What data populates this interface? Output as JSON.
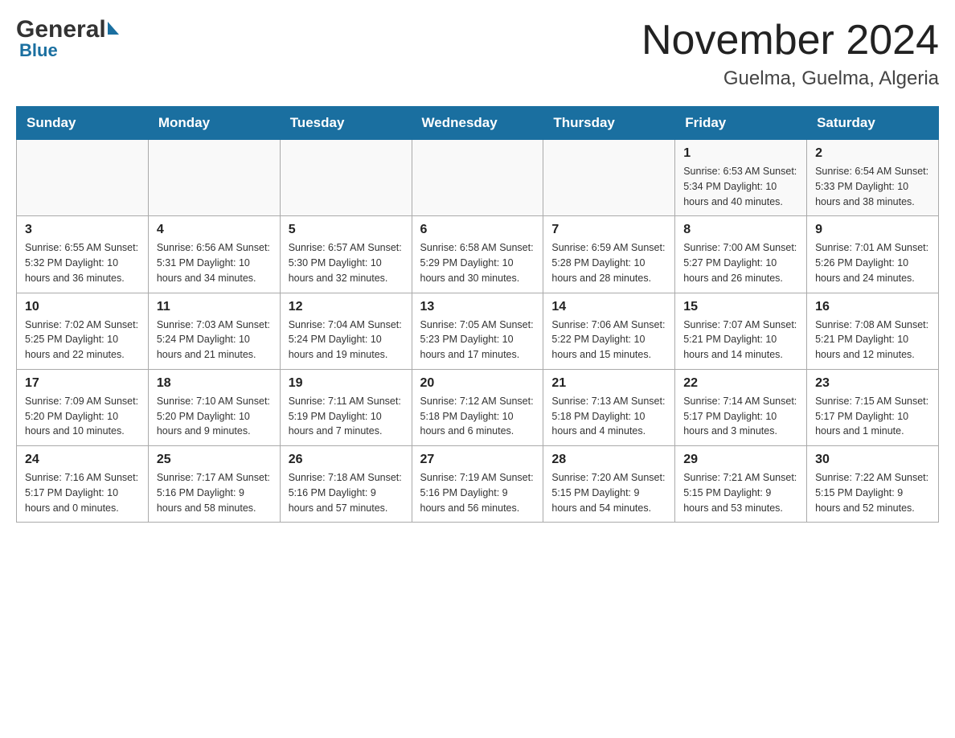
{
  "logo": {
    "general": "General",
    "blue": "Blue"
  },
  "title": "November 2024",
  "location": "Guelma, Guelma, Algeria",
  "days_of_week": [
    "Sunday",
    "Monday",
    "Tuesday",
    "Wednesday",
    "Thursday",
    "Friday",
    "Saturday"
  ],
  "weeks": [
    [
      {
        "day": "",
        "info": ""
      },
      {
        "day": "",
        "info": ""
      },
      {
        "day": "",
        "info": ""
      },
      {
        "day": "",
        "info": ""
      },
      {
        "day": "",
        "info": ""
      },
      {
        "day": "1",
        "info": "Sunrise: 6:53 AM\nSunset: 5:34 PM\nDaylight: 10 hours and 40 minutes."
      },
      {
        "day": "2",
        "info": "Sunrise: 6:54 AM\nSunset: 5:33 PM\nDaylight: 10 hours and 38 minutes."
      }
    ],
    [
      {
        "day": "3",
        "info": "Sunrise: 6:55 AM\nSunset: 5:32 PM\nDaylight: 10 hours and 36 minutes."
      },
      {
        "day": "4",
        "info": "Sunrise: 6:56 AM\nSunset: 5:31 PM\nDaylight: 10 hours and 34 minutes."
      },
      {
        "day": "5",
        "info": "Sunrise: 6:57 AM\nSunset: 5:30 PM\nDaylight: 10 hours and 32 minutes."
      },
      {
        "day": "6",
        "info": "Sunrise: 6:58 AM\nSunset: 5:29 PM\nDaylight: 10 hours and 30 minutes."
      },
      {
        "day": "7",
        "info": "Sunrise: 6:59 AM\nSunset: 5:28 PM\nDaylight: 10 hours and 28 minutes."
      },
      {
        "day": "8",
        "info": "Sunrise: 7:00 AM\nSunset: 5:27 PM\nDaylight: 10 hours and 26 minutes."
      },
      {
        "day": "9",
        "info": "Sunrise: 7:01 AM\nSunset: 5:26 PM\nDaylight: 10 hours and 24 minutes."
      }
    ],
    [
      {
        "day": "10",
        "info": "Sunrise: 7:02 AM\nSunset: 5:25 PM\nDaylight: 10 hours and 22 minutes."
      },
      {
        "day": "11",
        "info": "Sunrise: 7:03 AM\nSunset: 5:24 PM\nDaylight: 10 hours and 21 minutes."
      },
      {
        "day": "12",
        "info": "Sunrise: 7:04 AM\nSunset: 5:24 PM\nDaylight: 10 hours and 19 minutes."
      },
      {
        "day": "13",
        "info": "Sunrise: 7:05 AM\nSunset: 5:23 PM\nDaylight: 10 hours and 17 minutes."
      },
      {
        "day": "14",
        "info": "Sunrise: 7:06 AM\nSunset: 5:22 PM\nDaylight: 10 hours and 15 minutes."
      },
      {
        "day": "15",
        "info": "Sunrise: 7:07 AM\nSunset: 5:21 PM\nDaylight: 10 hours and 14 minutes."
      },
      {
        "day": "16",
        "info": "Sunrise: 7:08 AM\nSunset: 5:21 PM\nDaylight: 10 hours and 12 minutes."
      }
    ],
    [
      {
        "day": "17",
        "info": "Sunrise: 7:09 AM\nSunset: 5:20 PM\nDaylight: 10 hours and 10 minutes."
      },
      {
        "day": "18",
        "info": "Sunrise: 7:10 AM\nSunset: 5:20 PM\nDaylight: 10 hours and 9 minutes."
      },
      {
        "day": "19",
        "info": "Sunrise: 7:11 AM\nSunset: 5:19 PM\nDaylight: 10 hours and 7 minutes."
      },
      {
        "day": "20",
        "info": "Sunrise: 7:12 AM\nSunset: 5:18 PM\nDaylight: 10 hours and 6 minutes."
      },
      {
        "day": "21",
        "info": "Sunrise: 7:13 AM\nSunset: 5:18 PM\nDaylight: 10 hours and 4 minutes."
      },
      {
        "day": "22",
        "info": "Sunrise: 7:14 AM\nSunset: 5:17 PM\nDaylight: 10 hours and 3 minutes."
      },
      {
        "day": "23",
        "info": "Sunrise: 7:15 AM\nSunset: 5:17 PM\nDaylight: 10 hours and 1 minute."
      }
    ],
    [
      {
        "day": "24",
        "info": "Sunrise: 7:16 AM\nSunset: 5:17 PM\nDaylight: 10 hours and 0 minutes."
      },
      {
        "day": "25",
        "info": "Sunrise: 7:17 AM\nSunset: 5:16 PM\nDaylight: 9 hours and 58 minutes."
      },
      {
        "day": "26",
        "info": "Sunrise: 7:18 AM\nSunset: 5:16 PM\nDaylight: 9 hours and 57 minutes."
      },
      {
        "day": "27",
        "info": "Sunrise: 7:19 AM\nSunset: 5:16 PM\nDaylight: 9 hours and 56 minutes."
      },
      {
        "day": "28",
        "info": "Sunrise: 7:20 AM\nSunset: 5:15 PM\nDaylight: 9 hours and 54 minutes."
      },
      {
        "day": "29",
        "info": "Sunrise: 7:21 AM\nSunset: 5:15 PM\nDaylight: 9 hours and 53 minutes."
      },
      {
        "day": "30",
        "info": "Sunrise: 7:22 AM\nSunset: 5:15 PM\nDaylight: 9 hours and 52 minutes."
      }
    ]
  ]
}
